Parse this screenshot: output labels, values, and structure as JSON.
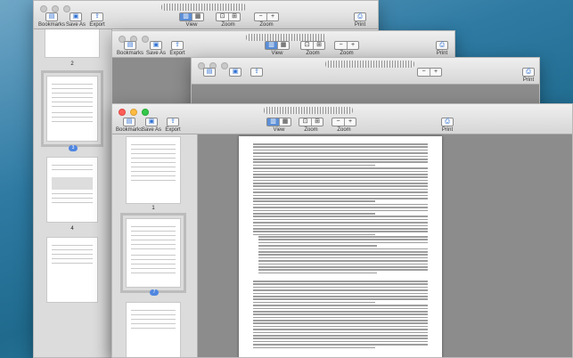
{
  "toolbar": {
    "bookmarks_label": "Bookmarks",
    "save_as_label": "Save As",
    "export_label": "Export",
    "view_label": "View",
    "zoom_label": "Zoom",
    "print_label": "Print"
  },
  "sidebar": {
    "page_numbers": [
      "2",
      "3",
      "4",
      "1",
      "7"
    ]
  }
}
